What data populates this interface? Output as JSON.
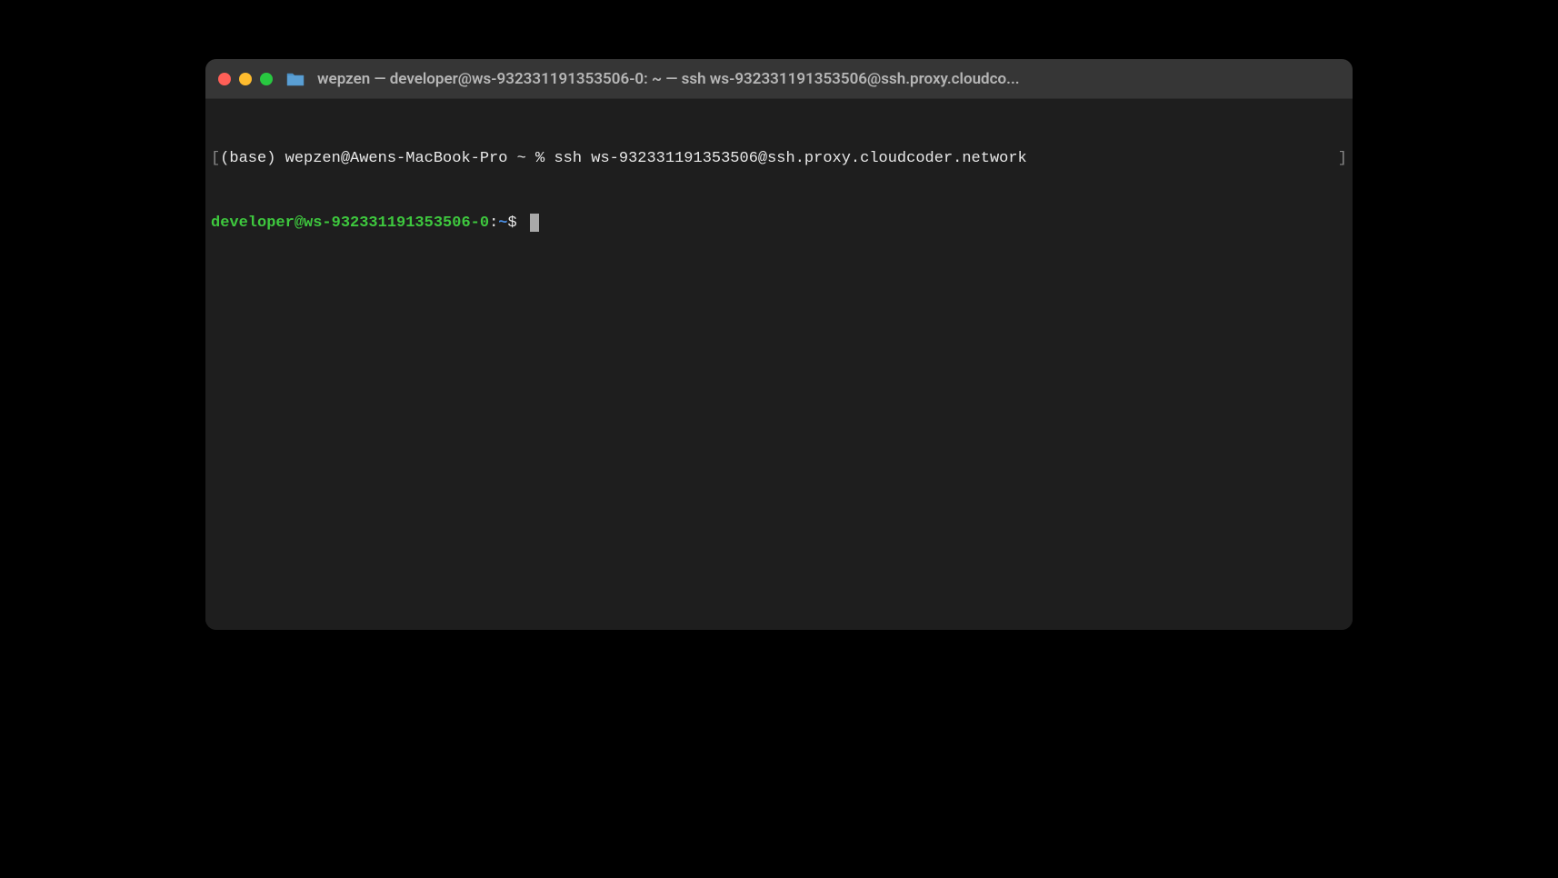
{
  "window": {
    "title": "wepzen — developer@ws-932331191353506-0: ~ — ssh ws-932331191353506@ssh.proxy.cloudco..."
  },
  "terminal": {
    "line1": {
      "open_bracket": "[",
      "prompt": "(base) wepzen@Awens-MacBook-Pro ~ % ",
      "command": "ssh ws-932331191353506@ssh.proxy.cloudcoder.network",
      "close_bracket": "]"
    },
    "line2": {
      "user_host": "developer@ws-932331191353506-0",
      "colon": ":",
      "path": "~",
      "dollar": "$ "
    }
  }
}
